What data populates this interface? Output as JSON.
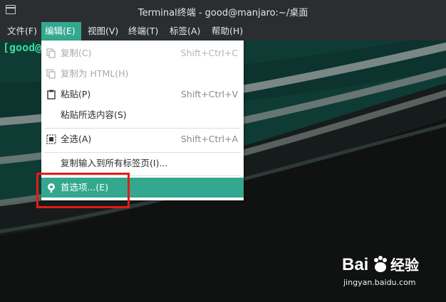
{
  "window": {
    "title": "Terminal终端 - good@manjaro:~/桌面"
  },
  "menubar": {
    "items": [
      {
        "label": "文件(F)"
      },
      {
        "label": "编辑(E)"
      },
      {
        "label": "视图(V)"
      },
      {
        "label": "终端(T)"
      },
      {
        "label": "标签(A)"
      },
      {
        "label": "帮助(H)"
      }
    ]
  },
  "terminal": {
    "prompt": "[good@"
  },
  "edit_menu": {
    "items": [
      {
        "label": "复制(C)",
        "shortcut": "Shift+Ctrl+C",
        "icon": "copy-icon",
        "enabled": false
      },
      {
        "label": "复制为 HTML(H)",
        "shortcut": "",
        "icon": "copy-html-icon",
        "enabled": false
      },
      {
        "label": "粘贴(P)",
        "shortcut": "Shift+Ctrl+V",
        "icon": "paste-icon",
        "enabled": true
      },
      {
        "label": "粘贴所选内容(S)",
        "shortcut": "",
        "icon": "",
        "enabled": true
      },
      {
        "label": "全选(A)",
        "shortcut": "Shift+Ctrl+A",
        "icon": "select-all-icon",
        "enabled": true
      },
      {
        "label": "复制输入到所有标签页(I)...",
        "shortcut": "",
        "icon": "",
        "enabled": true
      },
      {
        "label": "首选项...(E)",
        "shortcut": "",
        "icon": "preferences-icon",
        "enabled": true,
        "highlighted": true
      }
    ]
  },
  "colors": {
    "accent": "#33a88e",
    "annotation": "#e41b17",
    "terminal_bg": "#0f3b35"
  },
  "watermark": {
    "brand": "Baidu经验",
    "url": "jingyan.baidu.com"
  }
}
